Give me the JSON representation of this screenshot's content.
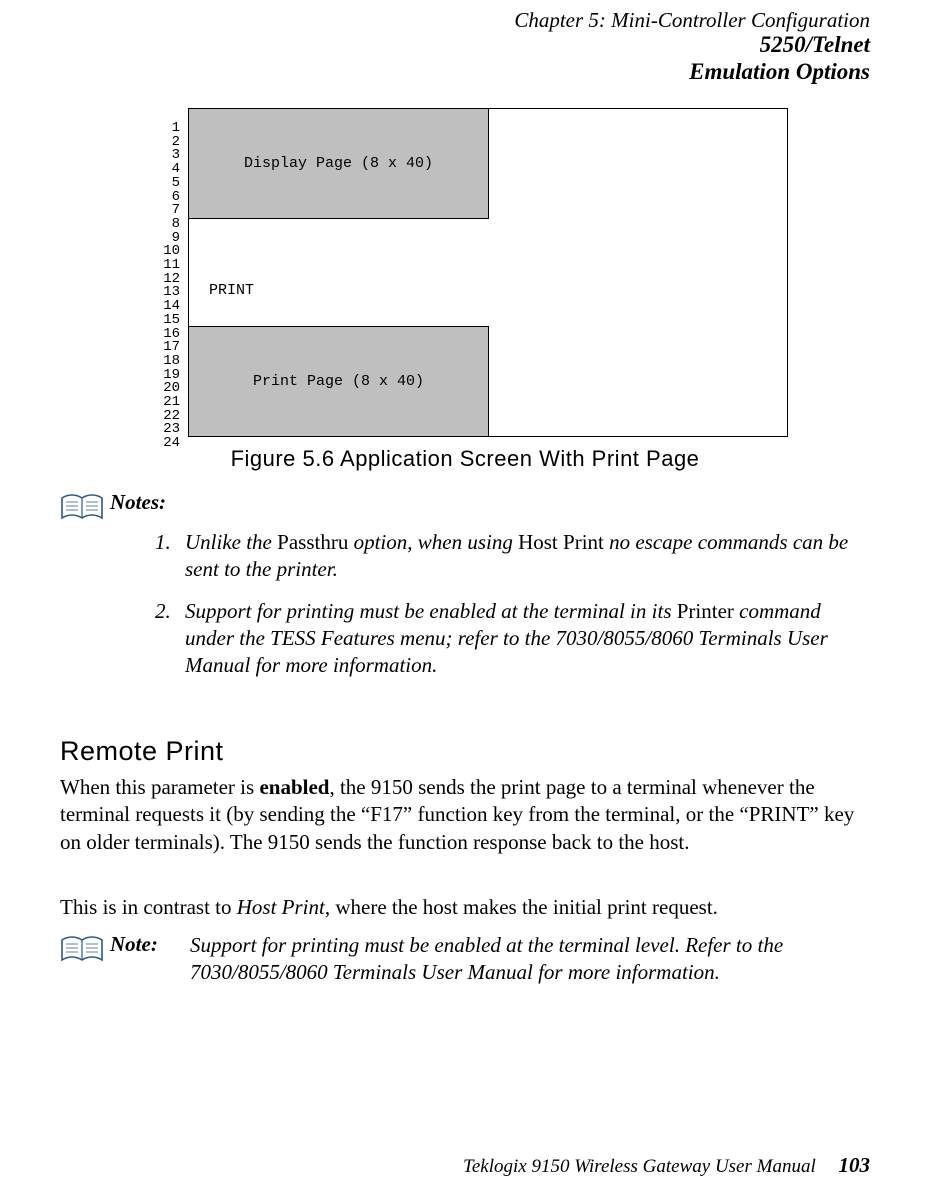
{
  "header": {
    "line1": "Chapter 5:  Mini-Controller Configuration",
    "line2": "5250/Telnet",
    "line3": "Emulation Options"
  },
  "diagram": {
    "rows": "1\n2\n3\n4\n5\n6\n7\n8\n9\n10\n11\n12\n13\n14\n15\n16\n17\n18\n19\n20\n21\n22\n23\n24",
    "display_label": "Display Page (8 x 40)",
    "print_word": "PRINT",
    "print_label": "Print Page (8 x 40)"
  },
  "caption": "Figure 5.6 Application Screen With Print Page",
  "notes": {
    "label": "Notes:",
    "item1_num": "1.",
    "item1_a": "Unlike the ",
    "item1_b": "Passthru",
    "item1_c": " option, when using ",
    "item1_d": "Host Print",
    "item1_e": " no escape commands can be sent to the printer.",
    "item2_num": "2.",
    "item2_a": "Support for printing must be enabled at the terminal in its ",
    "item2_b": "Printer",
    "item2_c": " command under the TESS Features menu; refer to the 7030/8055/8060 Terminals User Manual for more information."
  },
  "section_heading": "Remote Print",
  "para1_a": "When this parameter is ",
  "para1_b": "enabled",
  "para1_c": ", the 9150 sends the print page to a terminal whenever the terminal requests it (by sending the “F17” function key from the terminal, or the “PRINT” key on older terminals). The 9150 sends the function response back to the host.",
  "para2_a": "This is in contrast to ",
  "para2_b": "Host Print",
  "para2_c": ", where the host makes the initial print request.",
  "note2": {
    "label": "Note:",
    "text": "Support for printing must be enabled at the terminal level. Refer to the 7030/8055/8060 Terminals User Manual for more information."
  },
  "footer": {
    "title": "Teklogix 9150 Wireless Gateway User Manual",
    "page": "103"
  }
}
